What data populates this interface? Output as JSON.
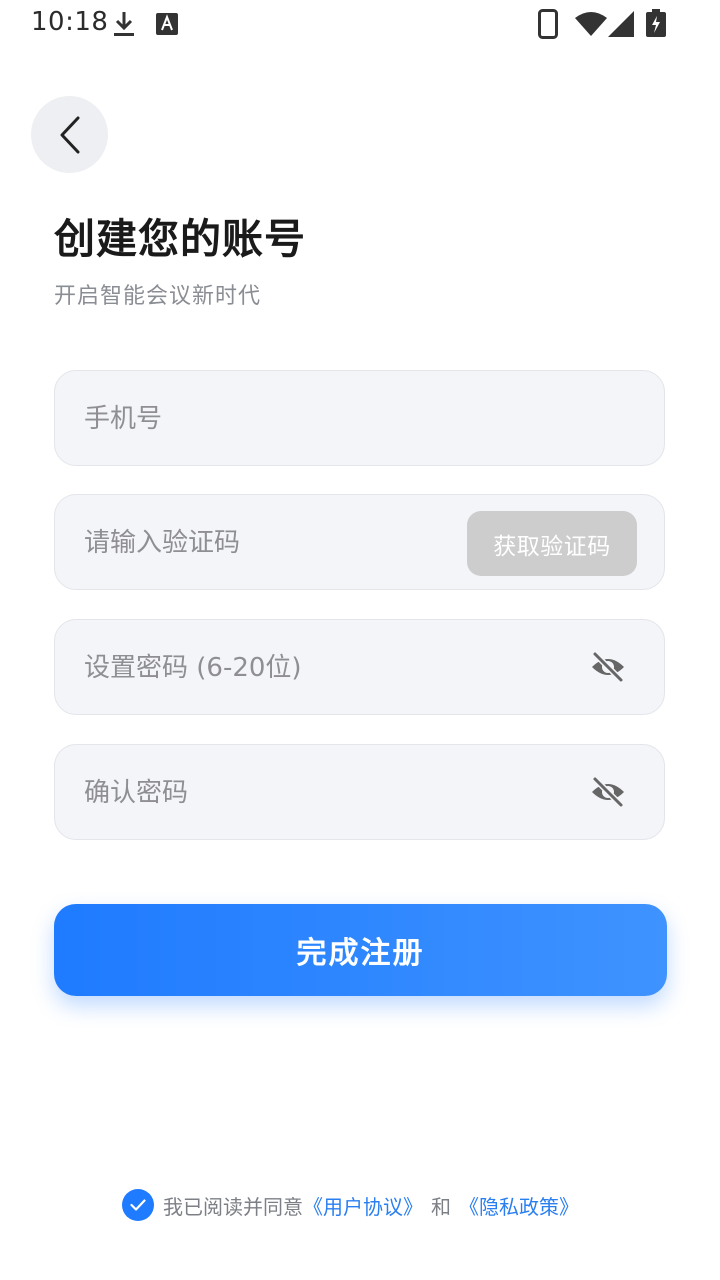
{
  "status_bar": {
    "time": "10:18"
  },
  "header": {
    "title": "创建您的账号",
    "subtitle": "开启智能会议新时代"
  },
  "form": {
    "phone": {
      "placeholder": "手机号",
      "value": ""
    },
    "code": {
      "placeholder": "请输入验证码",
      "value": "",
      "button_label": "获取验证码"
    },
    "password": {
      "placeholder": "设置密码 (6-20位)",
      "value": ""
    },
    "confirm": {
      "placeholder": "确认密码",
      "value": ""
    }
  },
  "submit_label": "完成注册",
  "agreement": {
    "checked": true,
    "prefix": "我已阅读并同意",
    "user_agreement": "《用户协议》",
    "and": "和",
    "privacy_policy": "《隐私政策》"
  },
  "colors": {
    "accent": "#1f7bff",
    "field_bg": "#f4f5f9",
    "disabled_button": "#cdcdcd"
  },
  "icons": [
    "download-icon",
    "keyboard-a-icon",
    "phone-icon",
    "wifi-icon",
    "signal-icon",
    "battery-icon",
    "back-chevron-icon",
    "eye-off-icon",
    "check-icon"
  ]
}
